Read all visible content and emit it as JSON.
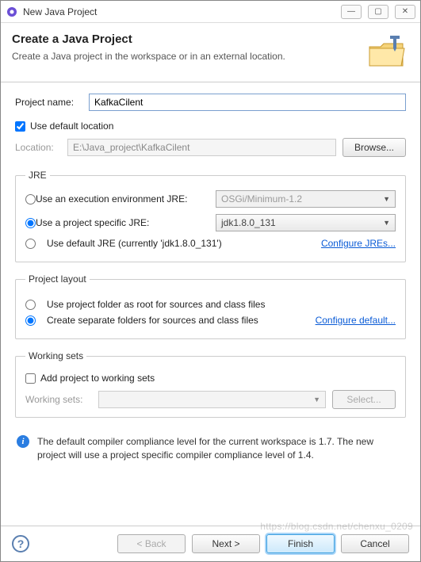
{
  "window": {
    "title": "New Java Project"
  },
  "header": {
    "title": "Create a Java Project",
    "description": "Create a Java project in the workspace or in an external location."
  },
  "project": {
    "name_label": "Project name:",
    "name_value": "KafkaCilent",
    "use_default_label": "Use default location",
    "use_default_checked": true,
    "location_label": "Location:",
    "location_value": "E:\\Java_project\\KafkaCilent",
    "browse_label": "Browse..."
  },
  "jre": {
    "legend": "JRE",
    "exec_env_label": "Use an execution environment JRE:",
    "exec_env_value": "OSGi/Minimum-1.2",
    "project_specific_label": "Use a project specific JRE:",
    "project_specific_value": "jdk1.8.0_131",
    "default_jre_label": "Use default JRE (currently 'jdk1.8.0_131')",
    "configure_link": "Configure JREs...",
    "selected": "project_specific"
  },
  "layout": {
    "legend": "Project layout",
    "root_label": "Use project folder as root for sources and class files",
    "separate_label": "Create separate folders for sources and class files",
    "configure_link": "Configure default...",
    "selected": "separate"
  },
  "working_sets": {
    "legend": "Working sets",
    "add_label": "Add project to working sets",
    "add_checked": false,
    "ws_label": "Working sets:",
    "select_label": "Select..."
  },
  "info": {
    "text": "The default compiler compliance level for the current workspace is 1.7. The new project will use a project specific compiler compliance level of 1.4."
  },
  "footer": {
    "back": "< Back",
    "next": "Next >",
    "finish": "Finish",
    "cancel": "Cancel"
  },
  "watermark": "https://blog.csdn.net/chenxu_0209"
}
